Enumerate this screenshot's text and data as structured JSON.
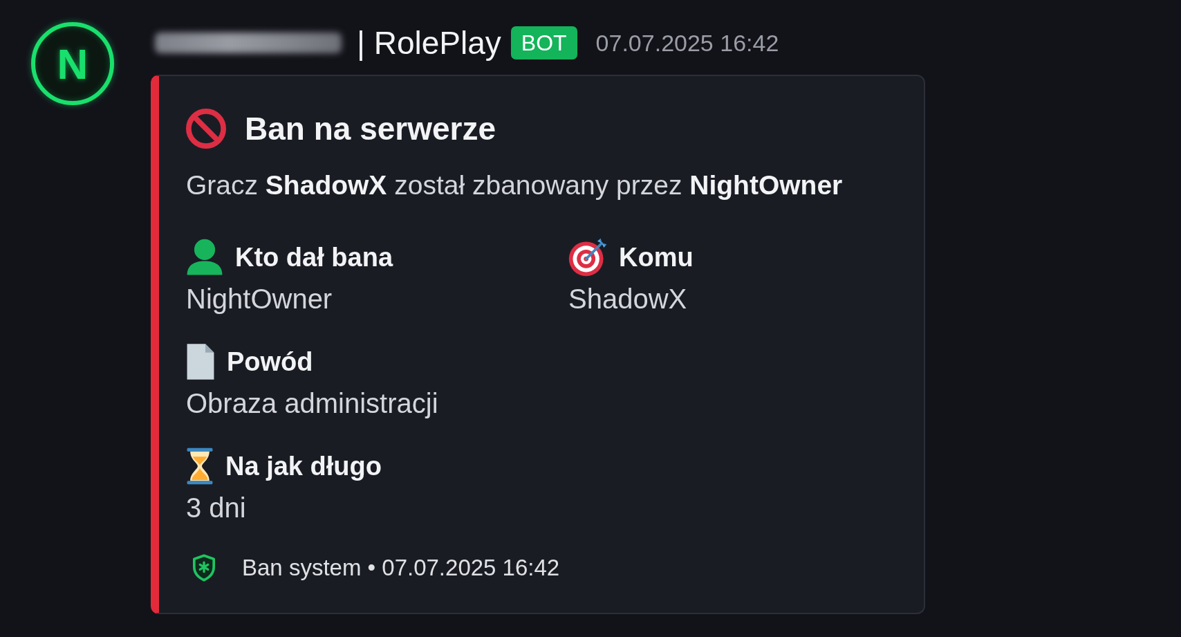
{
  "message": {
    "avatar": {
      "letter": "N"
    },
    "author": {
      "name": "| RolePlay",
      "badge": "BOT",
      "timestamp": "07.07.2025 16:42"
    },
    "embed": {
      "title": "Ban na serwerze",
      "description": "Gracz **ShadowX** został zbanowany przez **NightOwner**",
      "field_rows": [
        [
          {
            "kind": "person",
            "name": "Kto dał bana",
            "value": "NightOwner"
          },
          {
            "kind": "target",
            "name": "Komu",
            "value": "ShadowX"
          }
        ],
        [
          {
            "kind": "document",
            "name": "Powód",
            "value": "Obraza administracji"
          }
        ],
        [
          {
            "kind": "hourglass",
            "name": "Na jak długo",
            "value": "3 dni"
          }
        ]
      ],
      "footer": {
        "text": "Ban system • 07.07.2025 16:42"
      }
    }
  }
}
